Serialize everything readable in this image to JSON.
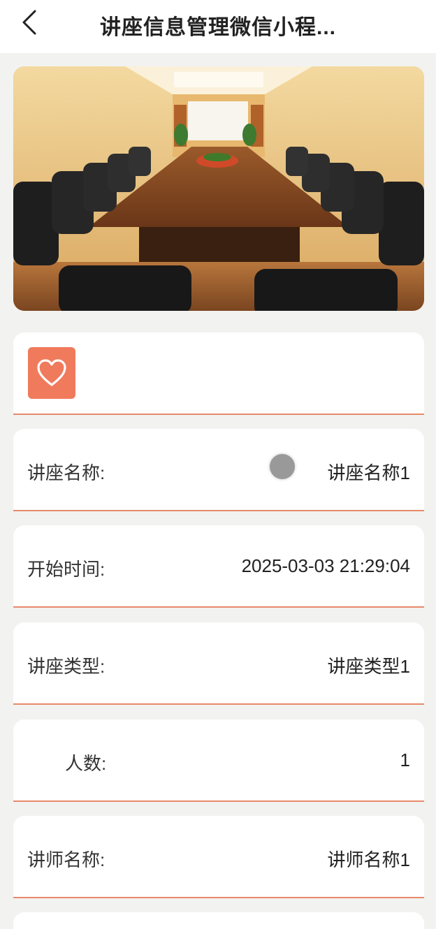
{
  "header": {
    "title": "讲座信息管理微信小程..."
  },
  "hero": {
    "image": "conference-room-photo"
  },
  "favorite": {
    "icon": "heart-icon",
    "color": "#f07a5c"
  },
  "fields": [
    {
      "label": "讲座名称:",
      "value": "讲座名称1"
    },
    {
      "label": "开始时间:",
      "value": "2025-03-03 21:29:04"
    },
    {
      "label": "讲座类型:",
      "value": "讲座类型1"
    },
    {
      "label": "人数:",
      "value": "1"
    },
    {
      "label": "讲师名称:",
      "value": "讲师名称1"
    }
  ],
  "colors": {
    "accent": "#e8896a",
    "background": "#f2f2f0"
  }
}
